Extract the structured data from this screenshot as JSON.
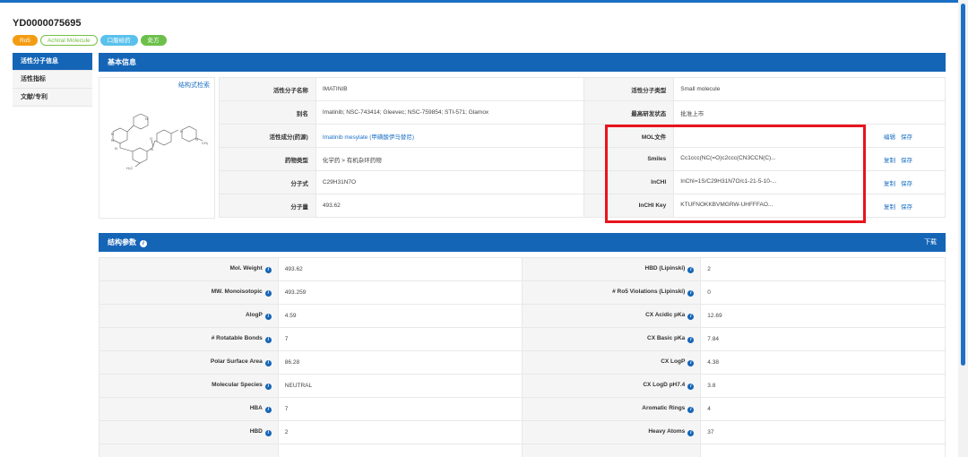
{
  "molecule": {
    "id": "YD0000075695"
  },
  "tags": [
    "Ro5",
    "Achiral Molecule",
    "口服给药",
    "处方"
  ],
  "sidebar": {
    "items": [
      "活性分子信息",
      "活性指标",
      "文献/专利"
    ]
  },
  "basic": {
    "header": "基本信息",
    "structure_search": "结构式检索",
    "rows": [
      {
        "l1": "活性分子名称",
        "v1": "IMATINIB",
        "l2": "活性分子类型",
        "v2": "Small molecule"
      },
      {
        "l1": "别名",
        "v1": "Imatinib; NSC-743414; Gleevec; NSC-759854; STI-571; Glamox",
        "l2": "最高研发状态",
        "v2": "批准上市"
      },
      {
        "l1": "活性成分(药源)",
        "v1": "Imatinib mesylate (甲磺酸伊马替尼)",
        "l2": "MOL文件",
        "v2": "",
        "a1": "编辑",
        "a2": "保存"
      },
      {
        "l1": "药物类型",
        "v1": "化学药 > 有机杂环药物",
        "l2": "Smiles",
        "v2": "Cc1ccc(NC(=O)c2ccc(CN3CCN(C)...",
        "a1": "复制",
        "a2": "保存"
      },
      {
        "l1": "分子式",
        "v1": "C29H31N7O",
        "l2": "InCHI",
        "v2": "InChI=1S/C29H31N7O/c1-21-5-10-...",
        "a1": "复制",
        "a2": "保存"
      },
      {
        "l1": "分子量",
        "v1": "493.62",
        "l2": "InCHI Key",
        "v2": "KTUFNOKKBVMGRW-UHFFFAO...",
        "a1": "复制",
        "a2": "保存"
      }
    ]
  },
  "params": {
    "header": "结构参数",
    "download": "下载",
    "rows": [
      {
        "l1": "Mol. Weight",
        "v1": "493.62",
        "l2": "HBD (Lipinski)",
        "v2": "2"
      },
      {
        "l1": "MW. Monoisotopic",
        "v1": "493.259",
        "l2": "# Ro5 Violations (Lipinski)",
        "v2": "0"
      },
      {
        "l1": "AlogP",
        "v1": "4.59",
        "l2": "CX Acidic pKa",
        "v2": "12.69"
      },
      {
        "l1": "# Rotatable Bonds",
        "v1": "7",
        "l2": "CX Basic pKa",
        "v2": "7.84"
      },
      {
        "l1": "Polar Surface Area",
        "v1": "86.28",
        "l2": "CX LogP",
        "v2": "4.38"
      },
      {
        "l1": "Molecular Species",
        "v1": "NEUTRAL",
        "l2": "CX LogD pH7.4",
        "v2": "3.8"
      },
      {
        "l1": "HBA",
        "v1": "7",
        "l2": "Aromatic Rings",
        "v2": "4"
      },
      {
        "l1": "HBD",
        "v1": "2",
        "l2": "Heavy Atoms",
        "v2": "37"
      },
      {
        "l1": "",
        "v1": "",
        "l2": "",
        "v2": ""
      }
    ]
  },
  "structure_atoms": {
    "n1": "N",
    "n2": "N",
    "n3": "N",
    "o": "O",
    "nh1": "N",
    "nh2": "N",
    "pip1": "N",
    "pip2": "N",
    "ch3": "CH₃",
    "h3c": "H₃C"
  },
  "colors": {
    "primary": "#1565b7",
    "link": "#1a6fc4",
    "highlight": "#e8141d"
  }
}
